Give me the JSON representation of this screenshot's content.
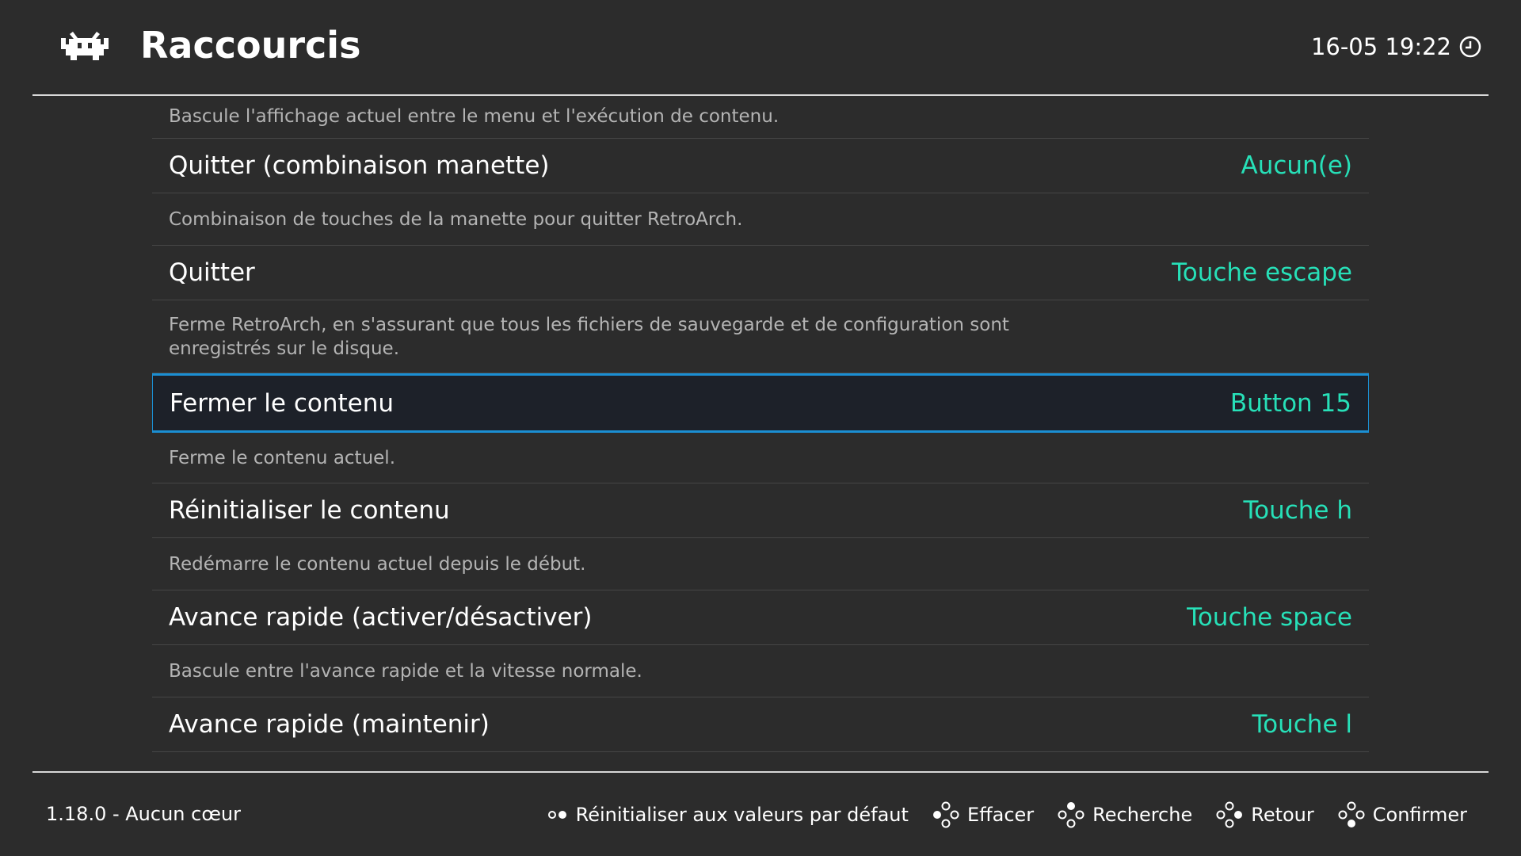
{
  "header": {
    "title": "Raccourcis",
    "datetime": "16-05 19:22",
    "logo": "retroarch-invader-logo",
    "clock_icon": "clock-icon"
  },
  "list": {
    "top_desc": "Bascule l'affichage actuel entre le menu et l'exécution de contenu.",
    "items": [
      {
        "label": "Quitter (combinaison manette)",
        "value": "Aucun(e)",
        "desc": "Combinaison de touches de la manette pour quitter RetroArch."
      },
      {
        "label": "Quitter",
        "value": "Touche escape",
        "desc": "Ferme RetroArch, en s'assurant que tous les fichiers de sauvegarde et de configuration sont enregistrés sur le disque."
      },
      {
        "label": "Fermer le contenu",
        "value": "Button 15",
        "desc": "Ferme le contenu actuel.",
        "selected": true
      },
      {
        "label": "Réinitialiser le contenu",
        "value": "Touche h",
        "desc": "Redémarre le contenu actuel depuis le début."
      },
      {
        "label": "Avance rapide (activer/désactiver)",
        "value": "Touche space",
        "desc": "Bascule entre l'avance rapide et la vitesse normale."
      },
      {
        "label": "Avance rapide (maintenir)",
        "value": "Touche l"
      }
    ]
  },
  "footer": {
    "version": "1.18.0 - Aucun cœur",
    "actions": [
      {
        "icon": "select-button-icon",
        "label": "Réinitialiser aux valeurs par défaut"
      },
      {
        "icon": "gamepad-left-button-icon",
        "label": "Effacer"
      },
      {
        "icon": "gamepad-top-button-icon",
        "label": "Recherche"
      },
      {
        "icon": "gamepad-right-button-icon",
        "label": "Retour"
      },
      {
        "icon": "gamepad-bottom-button-icon",
        "label": "Confirmer"
      }
    ]
  },
  "colors": {
    "value": "#27e0b8",
    "selection_border": "#1b8fd3",
    "background": "#2c2c2c"
  }
}
